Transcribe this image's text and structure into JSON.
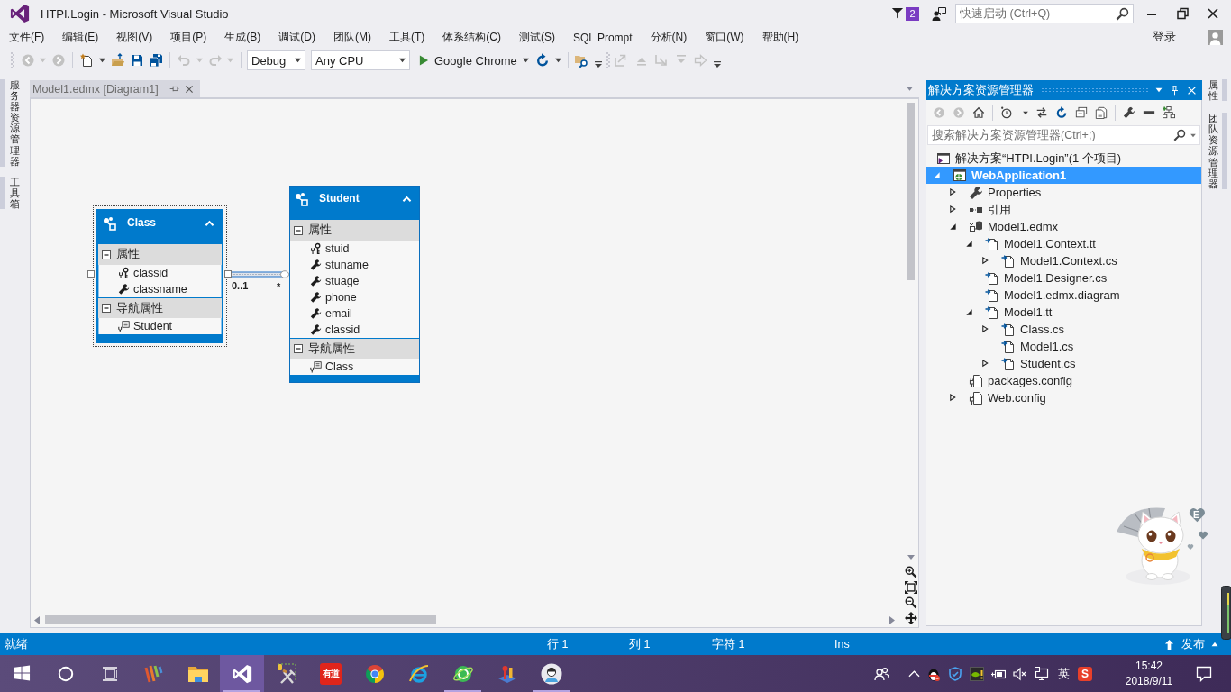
{
  "window": {
    "title": "HTPI.Login - Microsoft Visual Studio"
  },
  "title_bar": {
    "notification_count": "2",
    "quick_launch": {
      "placeholder": "快速启动 (Ctrl+Q)"
    }
  },
  "menu_bar": {
    "items": [
      "文件(F)",
      "编辑(E)",
      "视图(V)",
      "项目(P)",
      "生成(B)",
      "调试(D)",
      "团队(M)",
      "工具(T)",
      "体系结构(C)",
      "测试(S)",
      "SQL Prompt",
      "分析(N)",
      "窗口(W)",
      "帮助(H)"
    ],
    "sign_in": "登录"
  },
  "toolbar": {
    "configuration": "Debug",
    "platform": "Any CPU",
    "start_target": "Google Chrome"
  },
  "left_side_tabs": [
    "服务器资源管理器",
    "工具箱"
  ],
  "document_tabs": [
    {
      "label": "Model1.edmx [Diagram1]",
      "selected": true
    }
  ],
  "diagram": {
    "entities": [
      {
        "name": "Class",
        "selected": true,
        "sections": [
          {
            "title": "属性",
            "items": [
              {
                "name": "classid",
                "kind": "key"
              },
              {
                "name": "classname",
                "kind": "property"
              }
            ]
          },
          {
            "title": "导航属性",
            "items": [
              {
                "name": "Student",
                "kind": "navigation"
              }
            ]
          }
        ]
      },
      {
        "name": "Student",
        "selected": false,
        "sections": [
          {
            "title": "属性",
            "items": [
              {
                "name": "stuid",
                "kind": "key"
              },
              {
                "name": "stuname",
                "kind": "property"
              },
              {
                "name": "stuage",
                "kind": "property"
              },
              {
                "name": "phone",
                "kind": "property"
              },
              {
                "name": "email",
                "kind": "property"
              },
              {
                "name": "classid",
                "kind": "property"
              }
            ]
          },
          {
            "title": "导航属性",
            "items": [
              {
                "name": "Class",
                "kind": "navigation"
              }
            ]
          }
        ]
      }
    ],
    "associations": [
      {
        "source_multiplicity": "0..1",
        "target_multiplicity": "*"
      }
    ]
  },
  "solution_explorer": {
    "title": "解决方案资源管理器",
    "search": {
      "placeholder": "搜索解决方案资源管理器(Ctrl+;)"
    },
    "tree": [
      {
        "label": "解决方案“HTPI.Login”(1 个项目)",
        "kind": "solution",
        "selected": false,
        "children": [
          {
            "label": "WebApplication1",
            "kind": "project",
            "selected": true,
            "expanded": true,
            "children": [
              {
                "label": "Properties",
                "kind": "properties",
                "selected": false,
                "expanded": false
              },
              {
                "label": "引用",
                "kind": "references",
                "selected": false,
                "expanded": false
              },
              {
                "label": "Model1.edmx",
                "kind": "model",
                "selected": false,
                "expanded": true,
                "children": [
                  {
                    "label": "Model1.Context.tt",
                    "kind": "file",
                    "selected": false,
                    "expanded": true,
                    "children": [
                      {
                        "label": "Model1.Context.cs",
                        "kind": "file",
                        "selected": false,
                        "expanded": false
                      }
                    ]
                  },
                  {
                    "label": "Model1.Designer.cs",
                    "kind": "file",
                    "selected": false
                  },
                  {
                    "label": "Model1.edmx.diagram",
                    "kind": "file",
                    "selected": false
                  },
                  {
                    "label": "Model1.tt",
                    "kind": "file",
                    "selected": false,
                    "expanded": true,
                    "children": [
                      {
                        "label": "Class.cs",
                        "kind": "file",
                        "selected": false,
                        "expanded": false
                      },
                      {
                        "label": "Model1.cs",
                        "kind": "file",
                        "selected": false
                      },
                      {
                        "label": "Student.cs",
                        "kind": "file",
                        "selected": false,
                        "expanded": false
                      }
                    ]
                  }
                ]
              },
              {
                "label": "packages.config",
                "kind": "config",
                "selected": false
              },
              {
                "label": "Web.config",
                "kind": "config",
                "selected": false,
                "expanded": false
              }
            ]
          }
        ]
      }
    ]
  },
  "right_side_tabs": [
    "属性",
    "团队资源管理器"
  ],
  "mascot": {
    "badge": "E"
  },
  "status_bar": {
    "status": "就绪",
    "line": "行 1",
    "column": "列 1",
    "character": "字符 1",
    "insert_mode": "Ins",
    "publish": "发布"
  },
  "taskbar": {
    "apps": [
      {
        "kind": "stripes",
        "selected": false,
        "running": false
      },
      {
        "kind": "folder",
        "selected": false,
        "running": false
      },
      {
        "kind": "vs",
        "selected": true,
        "running": true
      },
      {
        "kind": "tools",
        "selected": false,
        "running": false
      },
      {
        "kind": "text-tile",
        "label": "有道",
        "selected": false,
        "running": false
      },
      {
        "kind": "tricolor",
        "selected": false,
        "running": false
      },
      {
        "kind": "ring",
        "selected": false,
        "running": false
      },
      {
        "kind": "orbit",
        "selected": false,
        "running": true
      },
      {
        "kind": "chart",
        "selected": false,
        "running": false
      },
      {
        "kind": "avatar",
        "selected": false,
        "running": true
      }
    ],
    "tray": {
      "input_mode": "英",
      "ime_logo": "S"
    },
    "time": "15:42",
    "date": "2018/9/11"
  }
}
